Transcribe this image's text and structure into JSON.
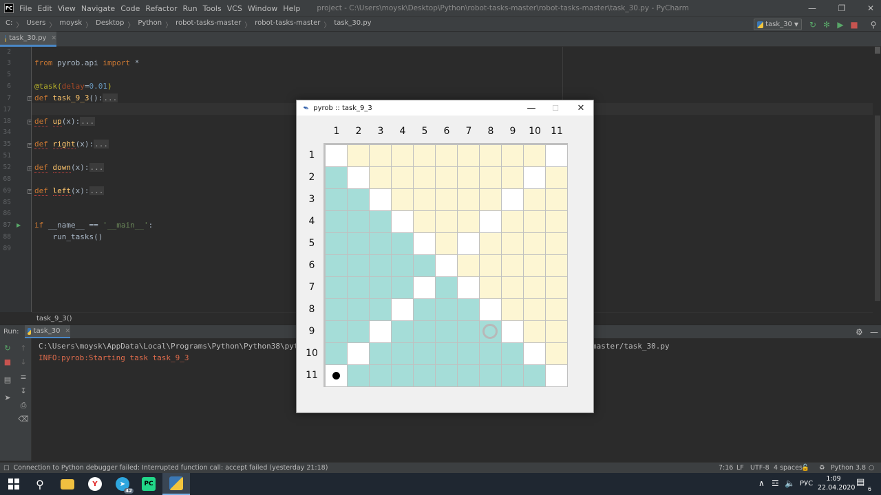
{
  "app": {
    "menu": [
      "File",
      "Edit",
      "View",
      "Navigate",
      "Code",
      "Refactor",
      "Run",
      "Tools",
      "VCS",
      "Window",
      "Help"
    ],
    "window_title": "project - C:\\Users\\moysk\\Desktop\\Python\\robot-tasks-master\\robot-tasks-master\\task_30.py - PyCharm",
    "logo": "PC"
  },
  "breadcrumbs": [
    "C:",
    "Users",
    "moysk",
    "Desktop",
    "Python",
    "robot-tasks-master",
    "robot-tasks-master",
    "task_30.py"
  ],
  "run_config": "task_30",
  "editor": {
    "tab": "task_30.py",
    "line_numbers": [
      "2",
      "3",
      "5",
      "6",
      "7",
      "17",
      "18",
      "34",
      "35",
      "51",
      "52",
      "68",
      "69",
      "85",
      "86",
      "87",
      "88",
      "89"
    ],
    "lines": [
      {
        "ln": "2",
        "text": ""
      },
      {
        "ln": "3",
        "parts": [
          {
            "t": "from",
            "c": "kw"
          },
          {
            "t": " pyrob.api "
          },
          {
            "t": "import",
            "c": "kw"
          },
          {
            "t": " *"
          }
        ]
      },
      {
        "ln": "5",
        "text": ""
      },
      {
        "ln": "6",
        "parts": [
          {
            "t": "@task(",
            "c": "dec"
          },
          {
            "t": "delay",
            "c": "par"
          },
          {
            "t": "="
          },
          {
            "t": "0.01",
            "c": "num"
          },
          {
            "t": ")",
            "c": "dec"
          }
        ]
      },
      {
        "ln": "7",
        "parts": [
          {
            "t": "def",
            "c": "kw"
          },
          {
            "t": " "
          },
          {
            "t": "task_9_3",
            "c": "fn"
          },
          {
            "t": "():"
          },
          {
            "t": "...",
            "c": "fold"
          }
        ]
      },
      {
        "ln": "17",
        "text": ""
      },
      {
        "ln": "18",
        "parts": [
          {
            "t": "def",
            "c": "kw uline"
          },
          {
            "t": " "
          },
          {
            "t": "up",
            "c": "fn uline"
          },
          {
            "t": "(x):"
          },
          {
            "t": "...",
            "c": "fold"
          }
        ]
      },
      {
        "ln": "34",
        "text": ""
      },
      {
        "ln": "35",
        "parts": [
          {
            "t": "def",
            "c": "kw uline"
          },
          {
            "t": " "
          },
          {
            "t": "right",
            "c": "fn uline"
          },
          {
            "t": "(x):"
          },
          {
            "t": "...",
            "c": "fold"
          }
        ]
      },
      {
        "ln": "51",
        "text": ""
      },
      {
        "ln": "52",
        "parts": [
          {
            "t": "def",
            "c": "kw uline"
          },
          {
            "t": " "
          },
          {
            "t": "down",
            "c": "fn uline"
          },
          {
            "t": "(x):"
          },
          {
            "t": "...",
            "c": "fold"
          }
        ]
      },
      {
        "ln": "68",
        "text": ""
      },
      {
        "ln": "69",
        "parts": [
          {
            "t": "def",
            "c": "kw uline"
          },
          {
            "t": " "
          },
          {
            "t": "left",
            "c": "fn uline"
          },
          {
            "t": "(x):"
          },
          {
            "t": "...",
            "c": "fold"
          }
        ]
      },
      {
        "ln": "85",
        "text": ""
      },
      {
        "ln": "86",
        "text": ""
      },
      {
        "ln": "87",
        "parts": [
          {
            "t": "if",
            "c": "kw"
          },
          {
            "t": " __name__ == "
          },
          {
            "t": "'__main__'",
            "c": "str"
          },
          {
            "t": ":"
          }
        ]
      },
      {
        "ln": "88",
        "parts": [
          {
            "t": "    run_tasks()"
          }
        ]
      },
      {
        "ln": "89",
        "text": ""
      }
    ],
    "breadcrumb_function": "task_9_3()"
  },
  "run": {
    "label": "Run:",
    "tab": "task_30",
    "console_lines": [
      {
        "text": "C:\\Users\\moysk\\AppData\\Local\\Programs\\Python\\Python38\\python",
        "color": "#bbbbbb"
      },
      {
        "text": "INFO:pyrob:Starting task task_9_3",
        "color": "#e06c4c"
      }
    ],
    "console_tail": "master/task_30.py"
  },
  "status": {
    "message": "Connection to Python debugger failed: Interrupted function call: accept failed (yesterday 21:18)",
    "position": "7:16",
    "line_sep": "LF",
    "encoding": "UTF-8",
    "indent": "4 spaces",
    "interpreter": "Python 3.8"
  },
  "taskbar": {
    "lang": "РУС",
    "time": "1:09",
    "date": "22.04.2020",
    "notif_count": "6",
    "telegram_badge": "42"
  },
  "dialog": {
    "title": "pyrob :: task_9_3",
    "columns": [
      "1",
      "2",
      "3",
      "4",
      "5",
      "6",
      "7",
      "8",
      "9",
      "10",
      "11"
    ],
    "rows": [
      "1",
      "2",
      "3",
      "4",
      "5",
      "6",
      "7",
      "8",
      "9",
      "10",
      "11"
    ],
    "colors": {
      "white": "#ffffff",
      "fill": "#a5ddd8",
      "target": "#fdf6d3"
    },
    "grid": [
      "WYYYYYYYYYW",
      "FWYYYYYYYWY",
      "FFWYYYYYWYY",
      "FFFWYYYWYYY",
      "FFFFWYWYYYY",
      "FFFFFWYYYYY",
      "FFFFWFWYYYY",
      "FFFWFFFWYYY",
      "FFWFFFFFWYY",
      "FWFFFFFFFWY",
      "WFFFFFFFFFW"
    ],
    "robot": {
      "row": 11,
      "col": 1
    },
    "goal": {
      "row": 9,
      "col": 8
    }
  }
}
